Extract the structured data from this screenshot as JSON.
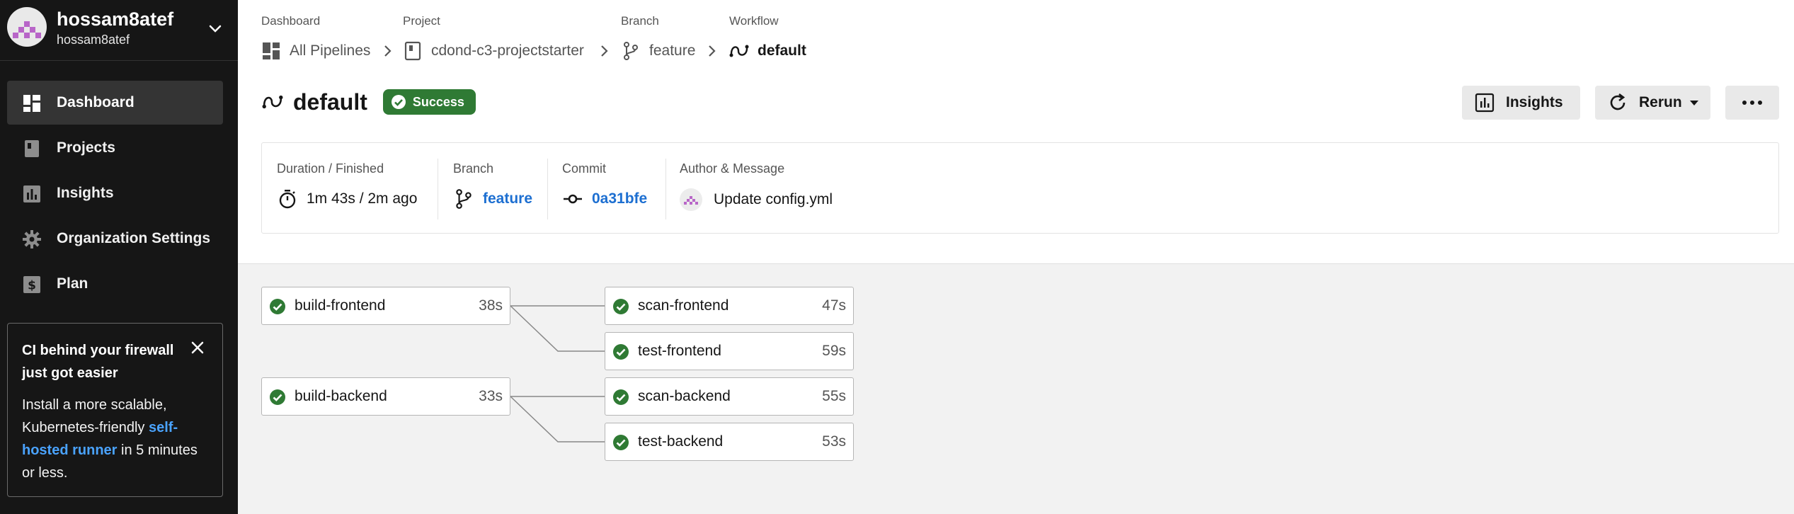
{
  "user": {
    "name": "hossam8atef",
    "username": "hossam8atef"
  },
  "nav": [
    {
      "label": "Dashboard",
      "icon": "dashboard-icon",
      "active": true
    },
    {
      "label": "Projects",
      "icon": "book-icon",
      "active": false
    },
    {
      "label": "Insights",
      "icon": "insights-icon",
      "active": false
    },
    {
      "label": "Organization Settings",
      "icon": "gear-icon",
      "active": false
    },
    {
      "label": "Plan",
      "icon": "dollar-icon",
      "active": false
    }
  ],
  "promo": {
    "title": "CI behind your firewall just got easier",
    "body_prefix": "Install a more scalable, Kubernetes-friendly ",
    "link": "self-hosted runner",
    "body_suffix": " in 5 minutes or less."
  },
  "breadcrumb": {
    "dashboard_label": "Dashboard",
    "dashboard_value": "All Pipelines",
    "project_label": "Project",
    "project_value": "cdond-c3-projectstarter",
    "branch_label": "Branch",
    "branch_value": "feature",
    "workflow_label": "Workflow",
    "workflow_value": "default"
  },
  "workflow": {
    "title": "default",
    "status": "Success"
  },
  "buttons": {
    "insights": "Insights",
    "rerun": "Rerun"
  },
  "meta": {
    "duration_label": "Duration / Finished",
    "duration_value": "1m 43s / 2m ago",
    "branch_label": "Branch",
    "branch_value": "feature",
    "commit_label": "Commit",
    "commit_value": "0a31bfe",
    "author_label": "Author & Message",
    "message": "Update config.yml"
  },
  "jobs": [
    {
      "name": "build-frontend",
      "duration": "38s",
      "status": "success"
    },
    {
      "name": "scan-frontend",
      "duration": "47s",
      "status": "success"
    },
    {
      "name": "test-frontend",
      "duration": "59s",
      "status": "success"
    },
    {
      "name": "build-backend",
      "duration": "33s",
      "status": "success"
    },
    {
      "name": "scan-backend",
      "duration": "55s",
      "status": "success"
    },
    {
      "name": "test-backend",
      "duration": "53s",
      "status": "success"
    }
  ],
  "colors": {
    "sidebar": "#161616",
    "success": "#2f7a34",
    "link": "#1d6fd1",
    "promo_link": "#4aa3ff"
  }
}
